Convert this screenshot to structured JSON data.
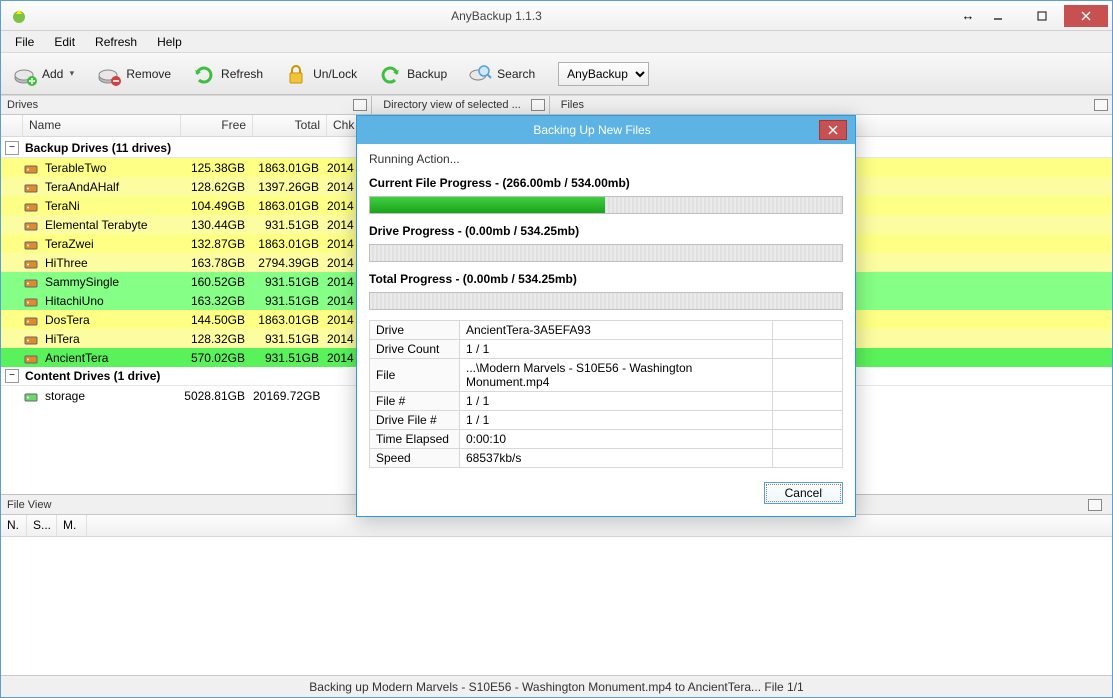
{
  "window": {
    "title": "AnyBackup 1.1.3"
  },
  "menu": {
    "file": "File",
    "edit": "Edit",
    "refresh": "Refresh",
    "help": "Help"
  },
  "toolbar": {
    "add": "Add",
    "remove": "Remove",
    "refresh": "Refresh",
    "unlock": "Un/Lock",
    "backup": "Backup",
    "search": "Search",
    "select_value": "AnyBackup"
  },
  "panels": {
    "drives": "Drives",
    "dirview": "Directory view of selected ...",
    "files": "Files",
    "fileview": "File View"
  },
  "columns": {
    "name": "Name",
    "free": "Free",
    "total": "Total",
    "chk": "Chk"
  },
  "fv_columns": {
    "n": "N.",
    "s": "S...",
    "m": "M."
  },
  "groups": {
    "backup": "Backup Drives (11 drives)",
    "content": "Content Drives (1 drive)"
  },
  "drives": {
    "backup": [
      {
        "name": "TerableTwo",
        "free": "125.38GB",
        "total": "1863.01GB",
        "chk": "2014",
        "cls": "yellow"
      },
      {
        "name": "TeraAndAHalf",
        "free": "128.62GB",
        "total": "1397.26GB",
        "chk": "2014",
        "cls": "yellow2"
      },
      {
        "name": "TeraNi",
        "free": "104.49GB",
        "total": "1863.01GB",
        "chk": "2014",
        "cls": "yellow"
      },
      {
        "name": "Elemental Terabyte",
        "free": "130.44GB",
        "total": "931.51GB",
        "chk": "2014",
        "cls": "yellow2"
      },
      {
        "name": "TeraZwei",
        "free": "132.87GB",
        "total": "1863.01GB",
        "chk": "2014",
        "cls": "yellow"
      },
      {
        "name": "HiThree",
        "free": "163.78GB",
        "total": "2794.39GB",
        "chk": "2014",
        "cls": "yellow2"
      },
      {
        "name": "SammySingle",
        "free": "160.52GB",
        "total": "931.51GB",
        "chk": "2014",
        "cls": "green"
      },
      {
        "name": "HitachiUno",
        "free": "163.32GB",
        "total": "931.51GB",
        "chk": "2014",
        "cls": "green"
      },
      {
        "name": "DosTera",
        "free": "144.50GB",
        "total": "1863.01GB",
        "chk": "2014",
        "cls": "yellow"
      },
      {
        "name": "HiTera",
        "free": "128.32GB",
        "total": "931.51GB",
        "chk": "2014",
        "cls": "yellow2"
      },
      {
        "name": "AncientTera",
        "free": "570.02GB",
        "total": "931.51GB",
        "chk": "2014",
        "cls": "green2"
      }
    ],
    "content": [
      {
        "name": "storage",
        "free": "5028.81GB",
        "total": "20169.72GB",
        "chk": "",
        "cls": "white"
      }
    ]
  },
  "dialog": {
    "title": "Backing Up New Files",
    "running": "Running Action...",
    "cfp_label": "Current File Progress - (266.00mb / 534.00mb)",
    "cfp_pct": 49.8,
    "dp_label": "Drive Progress - (0.00mb / 534.25mb)",
    "dp_pct": 0,
    "tp_label": "Total Progress - (0.00mb / 534.25mb)",
    "tp_pct": 0,
    "rows": [
      {
        "k": "Drive",
        "v": "AncientTera-3A5EFA93"
      },
      {
        "k": "Drive Count",
        "v": "1 / 1"
      },
      {
        "k": "File",
        "v": "...\\Modern Marvels - S10E56 - Washington Monument.mp4"
      },
      {
        "k": "File #",
        "v": "1 / 1"
      },
      {
        "k": "Drive File #",
        "v": "1 / 1"
      },
      {
        "k": "Time Elapsed",
        "v": "0:00:10"
      },
      {
        "k": "Speed",
        "v": "68537kb/s"
      }
    ],
    "cancel": "Cancel"
  },
  "status": "Backing up Modern Marvels - S10E56 - Washington Monument.mp4 to AncientTera... File 1/1"
}
